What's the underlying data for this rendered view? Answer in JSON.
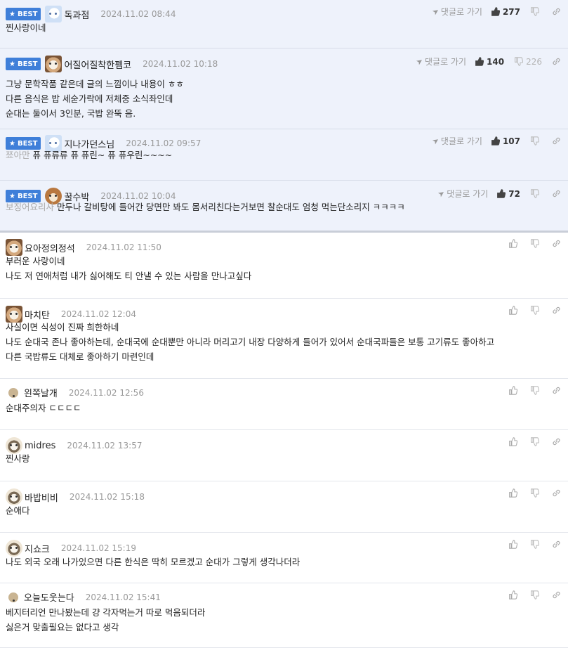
{
  "best_label": "BEST",
  "reply_label": "댓글로 가기",
  "comments": [
    {
      "best": true,
      "avatar": "white-dog-avatar",
      "nick": "독과점",
      "date": "2024.11.02 08:44",
      "likes": "277",
      "dislikes": "",
      "reply_link": true,
      "hint": "",
      "lines": [
        "찐사랑이네"
      ]
    },
    {
      "best": true,
      "avatar": "shiba-avatar",
      "nick": "어질어질착한펨코",
      "date": "2024.11.02 10:18",
      "likes": "140",
      "dislikes": "226",
      "reply_link": true,
      "hint": "",
      "lines": [
        "그냥 문학작품 같은데 글의 느낌이나 내용이 ㅎㅎ",
        "다른 음식은 밥 세숟가락에 저체중 소식좌인데",
        "순대는 둘이서 3인분, 국밥 완뚝 음."
      ]
    },
    {
      "best": true,
      "avatar": "white-dog-avatar",
      "nick": "지나가던스님",
      "date": "2024.11.02 09:57",
      "likes": "107",
      "dislikes": "",
      "reply_link": true,
      "hint": "쬬아만",
      "lines": [
        "퓨 퓨류류 퓨 퓨린~ 퓨 퓨우린~~~~"
      ]
    },
    {
      "best": true,
      "avatar": "corgi-avatar",
      "nick": "꿀수박",
      "date": "2024.11.02 10:04",
      "likes": "72",
      "dislikes": "",
      "reply_link": true,
      "hint": "보징어요리사",
      "lines": [
        "만두나 갈비탕에 들어간 당면만 봐도 몸서리친다는거보면 찰순대도 엄청 먹는단소리지 ㅋㅋㅋㅋ"
      ]
    },
    {
      "best": false,
      "avatar": "shiba-avatar",
      "nick": "요아정의정석",
      "date": "2024.11.02 11:50",
      "likes": "",
      "dislikes": "",
      "reply_link": false,
      "hint": "",
      "lines": [
        "부러운 사랑이네",
        "나도 저 연애처럼 내가 싫어해도 티 안낼 수 있는 사람을 만나고싶다"
      ]
    },
    {
      "best": false,
      "avatar": "shiba-avatar",
      "nick": "마치탄",
      "date": "2024.11.02 12:04",
      "likes": "",
      "dislikes": "",
      "reply_link": false,
      "hint": "",
      "lines": [
        "사실이면 식성이 진짜 희한하네",
        "나도 순대국 존나 좋아하는데, 순대국에 순대뿐만 아니라 머리고기 내장 다양하게 들어가 있어서 순대국파들은 보통 고기류도 좋아하고",
        "다른 국밥류도 대체로 좋아하기 마련인데"
      ]
    },
    {
      "best": false,
      "avatar": "default-round-avatar",
      "nick": "왼쪽날개",
      "date": "2024.11.02 12:56",
      "likes": "",
      "dislikes": "",
      "reply_link": false,
      "hint": "",
      "lines": [
        "순대주의자 ㄷㄷㄷㄷ"
      ]
    },
    {
      "best": false,
      "avatar": "puppy-avatar",
      "nick": "midres",
      "date": "2024.11.02 13:57",
      "likes": "",
      "dislikes": "",
      "reply_link": false,
      "hint": "",
      "lines": [
        "찐사랑"
      ]
    },
    {
      "best": false,
      "avatar": "puppy-avatar",
      "nick": "바밥비비",
      "date": "2024.11.02 15:18",
      "likes": "",
      "dislikes": "",
      "reply_link": false,
      "hint": "",
      "lines": [
        "순애다"
      ]
    },
    {
      "best": false,
      "avatar": "puppy-avatar",
      "nick": "지쇼크",
      "date": "2024.11.02 15:19",
      "likes": "",
      "dislikes": "",
      "reply_link": false,
      "hint": "",
      "lines": [
        "나도 외국 오래 나가있으면 다른 한식은 딱히 모르겠고 순대가 그렇게 생각나더라"
      ]
    },
    {
      "best": false,
      "avatar": "default-round-avatar",
      "nick": "오늘도웃는다",
      "date": "2024.11.02 15:41",
      "likes": "",
      "dislikes": "",
      "reply_link": false,
      "hint": "",
      "lines": [
        "베지터리언 만나봤는데 걍 각자먹는거 따로 먹음되더라",
        "싫은거 맞출필요는 없다고 생각"
      ]
    }
  ],
  "colors": {
    "best_badge": "#3f7fd9",
    "best_bg": "#eef2fb",
    "muted": "#999999"
  }
}
